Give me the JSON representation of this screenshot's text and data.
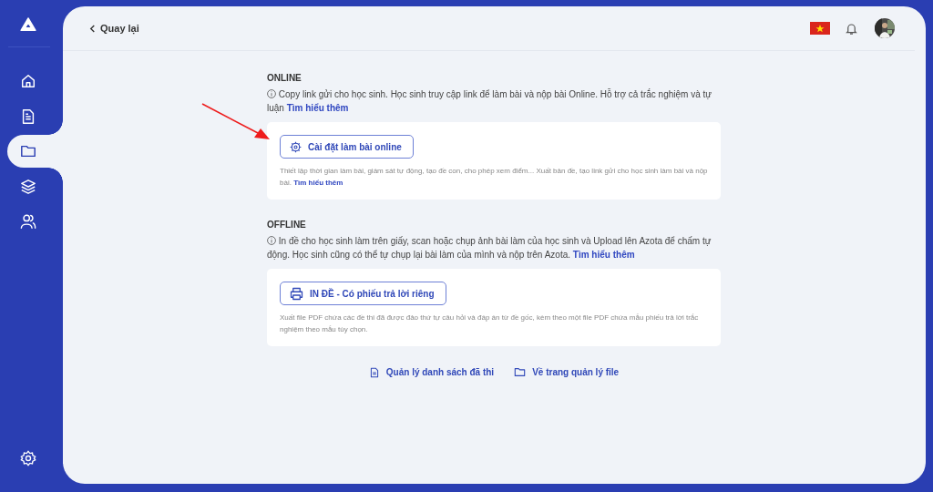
{
  "sidebar": {
    "items": [
      {
        "selected": false
      },
      {
        "selected": false
      },
      {
        "selected": true
      },
      {
        "selected": false
      },
      {
        "selected": false
      }
    ]
  },
  "header": {
    "back": "Quay lại"
  },
  "sections": [
    {
      "title": "ONLINE",
      "description": "Copy link gửi cho học sinh. Học sinh truy cập link để làm bài và nộp bài Online. Hỗ trợ cả trắc nghiệm và tự luận",
      "link": "Tìm hiểu thêm",
      "button": "Cài đặt làm bài online",
      "card_text": "Thiết lập thời gian làm bài, giám sát tự động, tạo đề con, cho phép xem điểm... Xuất bản đề, tạo link gửi cho học sinh làm bài và nộp bài.",
      "card_link": "Tìm hiểu thêm"
    },
    {
      "title": "OFFLINE",
      "description": "In đề cho học sinh làm trên giấy, scan hoặc chụp ảnh bài làm của học sinh và Upload lên Azota để chấm tự động. Học sinh cũng có thể tự chụp lại bài làm của mình và nộp trên Azota.",
      "link": "Tìm hiểu thêm",
      "button": "IN ĐỀ - Có phiếu trả lời riêng",
      "card_text": "Xuất file PDF chứa các đề thi đã được đảo thứ tự câu hỏi và đáp án từ đề gốc, kèm theo một file PDF chứa mẫu phiếu trả lời trắc nghiệm theo mẫu tùy chọn."
    }
  ],
  "footer_links": [
    "Quản lý danh sách đã thi",
    "Về trang quản lý file"
  ]
}
